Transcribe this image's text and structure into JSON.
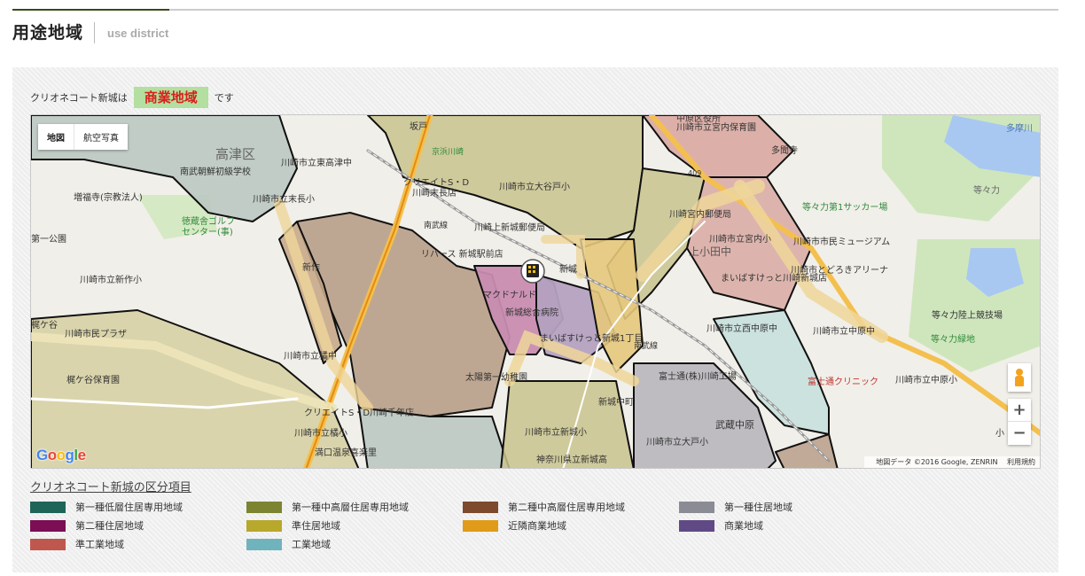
{
  "header": {
    "title": "用途地域",
    "subtitle": "use district"
  },
  "status": {
    "prefix": "クリオネコート新城は",
    "district": "商業地域",
    "suffix": "です",
    "district_bg": "#b3dfa0",
    "district_color": "#d8211a"
  },
  "map": {
    "type_buttons": [
      "地図",
      "航空写真"
    ],
    "labels": [
      "高津区",
      "坂戸",
      "京浜川崎",
      "中原区役所",
      "川崎市立宮内保育園",
      "南武朝鮮初級学校",
      "川崎市立東高津中",
      "多摩川",
      "多聞寺",
      "クリエイトS・D",
      "川崎末長店",
      "川崎市立大谷戸小",
      "増福寺(宗教法人)",
      "川崎市立末長小",
      "409",
      "等々力",
      "徳蔵舎ゴルフ",
      "センター(事)",
      "川崎上新城郵便局",
      "川崎宮内郵便局",
      "等々力第1サッカー場",
      "第一公園",
      "南武線",
      "リバース 新城駅前店",
      "川崎市立宮内小",
      "川崎市市民ミュージアム",
      "新作",
      "上小田中",
      "川崎市とどろきアリーナ",
      "川崎市立新作小",
      "新城",
      "マクドナルド",
      "まいばすけっと川崎新城店",
      "梶ケ谷",
      "新城総合病院",
      "等々力陸上競技場",
      "川崎市民プラザ",
      "川崎市立西中原中",
      "まいばすけっと新城1丁目",
      "川崎市立中原中",
      "等々力緑地",
      "川崎市立橘中",
      "南武線",
      "太陽第一幼稚園",
      "富士通(株)川崎工場",
      "富士通クリニック",
      "川崎市立中原小",
      "梶ケ谷保育園",
      "新城中町",
      "クリエイトS・D川崎千年店",
      "武蔵中原",
      "川崎市立新城小",
      "川崎市立大戸小",
      "川崎市立橘小",
      "満口温泉喜楽里",
      "神奈川県立新城高",
      "小"
    ],
    "property_icon": "building-marker-icon",
    "zoom_in": "+",
    "zoom_out": "−",
    "google": [
      "G",
      "o",
      "o",
      "g",
      "l",
      "e"
    ],
    "google_colors": [
      "#4285f4",
      "#ea4335",
      "#fbbc05",
      "#4285f4",
      "#34a853",
      "#ea4335"
    ],
    "attribution": "地図データ ©2016 Google, ZENRIN",
    "terms": "利用規約"
  },
  "legend": {
    "title": "クリオネコート新城の区分項目",
    "items": [
      {
        "label": "第一種低層住居専用地域",
        "color": "#1f6459"
      },
      {
        "label": "第一種中高層住居専用地域",
        "color": "#7c8432"
      },
      {
        "label": "第二種中高層住居専用地域",
        "color": "#7e4a2e"
      },
      {
        "label": "第一種住居地域",
        "color": "#8b8b95"
      },
      {
        "label": "第二種住居地域",
        "color": "#7b0e54"
      },
      {
        "label": "準住居地域",
        "color": "#b8a82c"
      },
      {
        "label": "近隣商業地域",
        "color": "#e09b19"
      },
      {
        "label": "商業地域",
        "color": "#5f4a86"
      },
      {
        "label": "準工業地域",
        "color": "#c0574e"
      },
      {
        "label": "工業地域",
        "color": "#6fb4bd"
      }
    ]
  }
}
